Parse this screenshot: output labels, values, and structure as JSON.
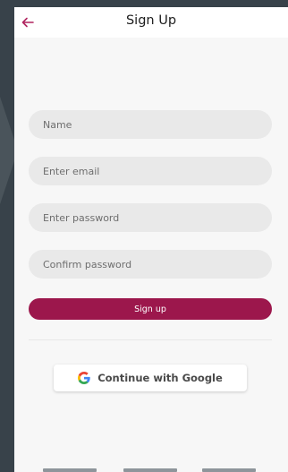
{
  "header": {
    "title": "Sign Up",
    "back_icon": "arrow-left-icon",
    "accent_color": "#9c174c"
  },
  "form": {
    "name_placeholder": "Name",
    "name_value": "",
    "email_placeholder": "Enter email",
    "email_value": "",
    "password_placeholder": "Enter password",
    "password_value": "",
    "confirm_placeholder": "Confirm password",
    "confirm_value": "",
    "signup_label": "Sign up",
    "signup_color": "#9c174c"
  },
  "social": {
    "google_label": "Continue with Google",
    "google_icon": "google-g-icon"
  },
  "system_nav": {
    "items": [
      "back-nav-icon",
      "home-nav-icon",
      "recents-nav-icon"
    ]
  }
}
